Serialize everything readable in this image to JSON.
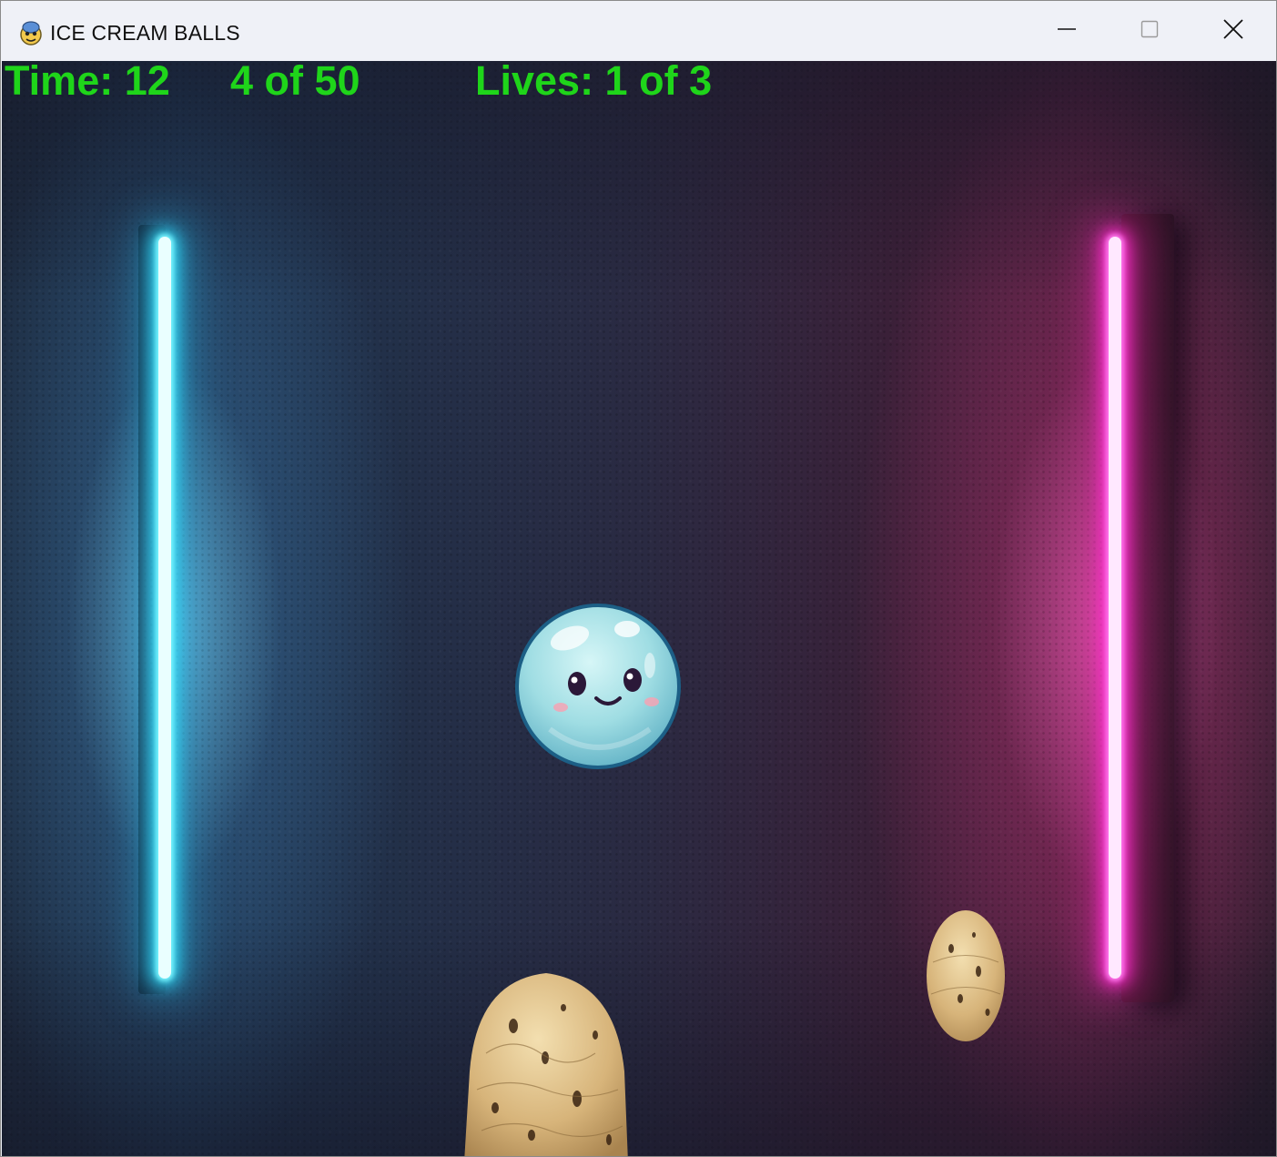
{
  "window": {
    "title": "ICE CREAM BALLS",
    "app_icon": "python-icon",
    "controls": {
      "minimize": "minimize-icon",
      "maximize": "maximize-icon",
      "close": "close-icon"
    }
  },
  "hud": {
    "time": "Time: 12",
    "progress": "4 of 50",
    "lives": "Lives: 1 of 3",
    "color": "#1fd51a"
  },
  "scene": {
    "left_neon_color": "#2fd6f4",
    "right_neon_color": "#ff2fd0"
  }
}
